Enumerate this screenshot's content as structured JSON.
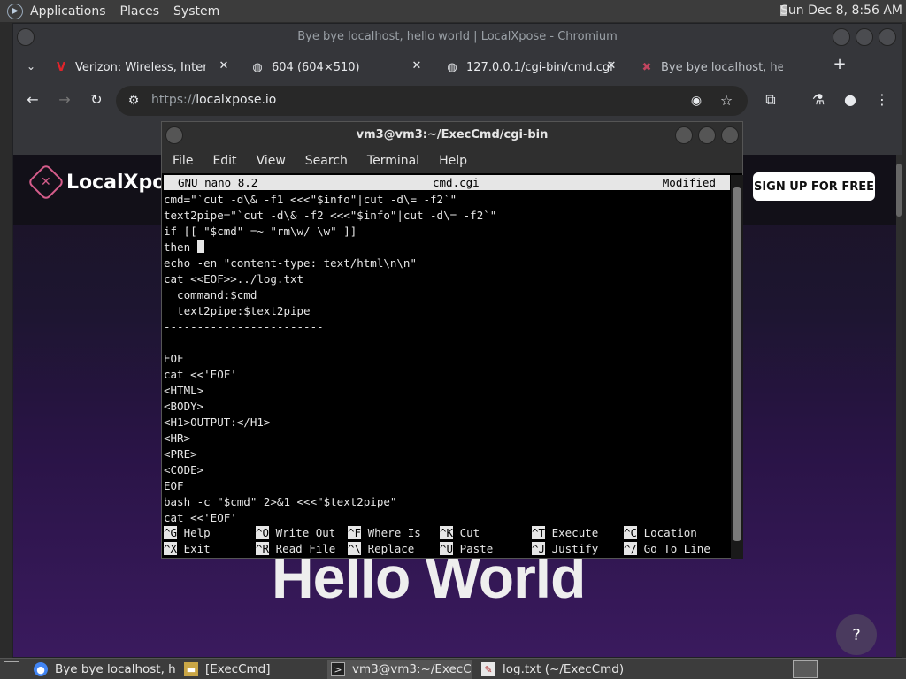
{
  "top_panel": {
    "menus": [
      "Applications",
      "Places",
      "System"
    ],
    "clock": "Sun Dec  8,  8:56 AM"
  },
  "browser": {
    "window_title": "Bye bye localhost, hello world | LocalXpose - Chromium",
    "tabs": [
      {
        "label": "Verizon: Wireless, Interne",
        "icon": "verizon-icon"
      },
      {
        "label": "604 (604×510)",
        "icon": "globe-icon"
      },
      {
        "label": "127.0.0.1/cgi-bin/cmd.cgi",
        "icon": "globe-icon"
      },
      {
        "label": "Bye bye localhost, hello w",
        "icon": "localxpose-icon"
      }
    ],
    "url_scheme": "https://",
    "url_host": "localxpose.io"
  },
  "page": {
    "brand": "LocalXpose",
    "signup": "SIGN UP FOR FREE",
    "hero": "Hello World",
    "help": "?"
  },
  "terminal": {
    "title": "vm3@vm3:~/ExecCmd/cgi-bin",
    "menus": [
      "File",
      "Edit",
      "View",
      "Search",
      "Terminal",
      "Help"
    ],
    "nano": {
      "version": "GNU nano 8.2",
      "filename": "cmd.cgi",
      "status": "Modified"
    },
    "lines": [
      "cmd=\"`cut -d\\& -f1 <<<\"$info\"|cut -d\\= -f2`\"",
      "text2pipe=\"`cut -d\\& -f2 <<<\"$info\"|cut -d\\= -f2`\"",
      "if [[ \"$cmd\" =~ \"rm\\w/ \\w\" ]]",
      "then ",
      "echo -en \"content-type: text/html\\n\\n\"",
      "cat <<EOF>>../log.txt",
      "  command:$cmd",
      "  text2pipe:$text2pipe",
      "------------------------",
      "",
      "EOF",
      "cat <<'EOF'",
      "<HTML>",
      "<BODY>",
      "<H1>OUTPUT:</H1>",
      "<HR>",
      "<PRE>",
      "<CODE>",
      "EOF",
      "bash -c \"$cmd\" 2>&1 <<<\"$text2pipe\"",
      "cat <<'EOF'"
    ],
    "shortcuts_row1": [
      {
        "key": "^G",
        "label": "Help"
      },
      {
        "key": "^O",
        "label": "Write Out"
      },
      {
        "key": "^F",
        "label": "Where Is"
      },
      {
        "key": "^K",
        "label": "Cut"
      },
      {
        "key": "^T",
        "label": "Execute"
      },
      {
        "key": "^C",
        "label": "Location"
      }
    ],
    "shortcuts_row2": [
      {
        "key": "^X",
        "label": "Exit"
      },
      {
        "key": "^R",
        "label": "Read File"
      },
      {
        "key": "^\\",
        "label": "Replace"
      },
      {
        "key": "^U",
        "label": "Paste"
      },
      {
        "key": "^J",
        "label": "Justify"
      },
      {
        "key": "^/",
        "label": "Go To Line"
      }
    ]
  },
  "taskbar": {
    "items": [
      {
        "label": "Bye bye localhost, h...",
        "icon": "chromium-icon"
      },
      {
        "label": "[ExecCmd]",
        "icon": "folder-icon"
      },
      {
        "label": "vm3@vm3:~/ExecC...",
        "icon": "terminal-icon"
      },
      {
        "label": "log.txt (~/ExecCmd) ...",
        "icon": "text-editor-icon"
      }
    ]
  }
}
